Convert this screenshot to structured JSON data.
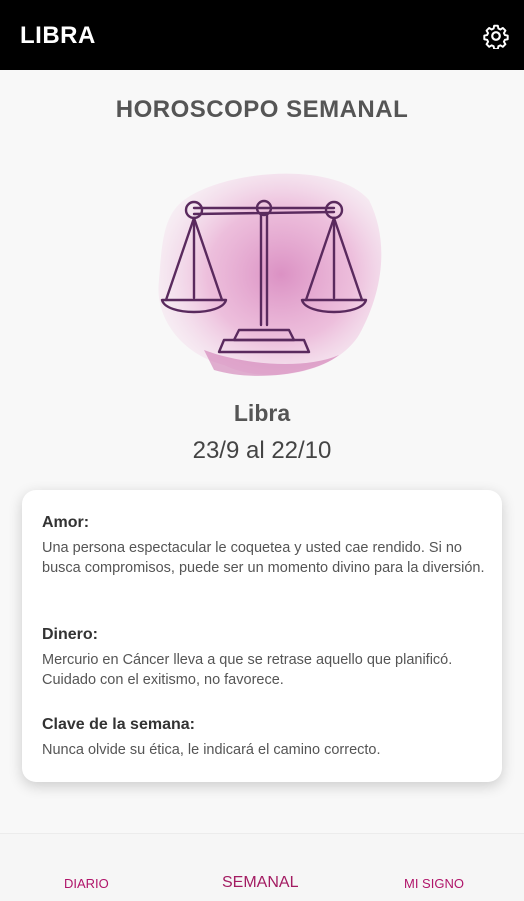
{
  "appbar": {
    "title": "LIBRA",
    "settings_icon": "gear-icon"
  },
  "page": {
    "title": "HOROSCOPO SEMANAL"
  },
  "sign": {
    "name": "Libra",
    "dates": "23/9 al 22/10",
    "illustration_icon": "libra-scales-icon"
  },
  "sections": [
    {
      "heading": "Amor:",
      "text": "Una persona espectacular le coquetea y usted cae rendido. Si no busca compromisos, puede ser un momento divino para la diversión."
    },
    {
      "heading": "Dinero:",
      "text": "Mercurio en Cáncer lleva a que se retrase aquello que planificó. Cuidado con el exitismo, no favorece."
    },
    {
      "heading": "Clave de la semana:",
      "text": "Nunca olvide su ética, le indicará el camino correcto."
    }
  ],
  "bottom_nav": {
    "items": [
      {
        "label": "DIARIO"
      },
      {
        "label": "SEMANAL"
      },
      {
        "label": "MI SIGNO"
      }
    ],
    "active": "SEMANAL"
  },
  "colors": {
    "appbar": "#000000",
    "accent": "#b0156a",
    "watercolor": "#e8a6d0"
  }
}
